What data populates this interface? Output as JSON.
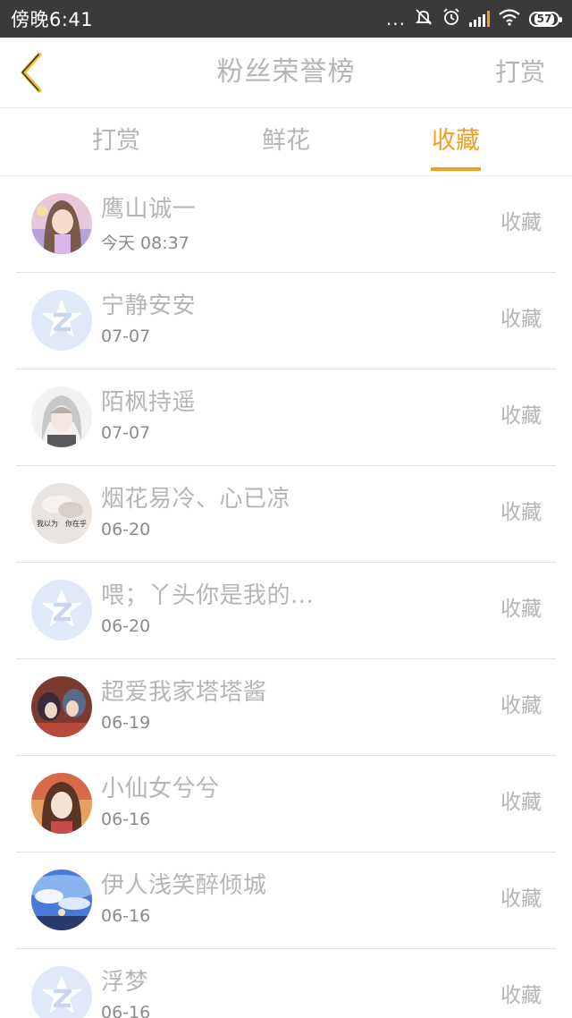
{
  "status_bar": {
    "time": "傍晚6:41",
    "dots": "...",
    "mute_glyph": "🔕",
    "alarm_glyph": "⏰",
    "wifi_glyph": "📶",
    "battery": "57"
  },
  "nav": {
    "title": "粉丝荣誉榜",
    "action": "打赏",
    "accent_color": "#f0a020"
  },
  "tabs": [
    {
      "label": "打赏",
      "active": false
    },
    {
      "label": "鲜花",
      "active": false
    },
    {
      "label": "收藏",
      "active": true
    }
  ],
  "list": [
    {
      "name": "鹰山诚一",
      "time": "今天 08:37",
      "action": "收藏",
      "avatar": "anime-girl-pastel"
    },
    {
      "name": "宁静安安",
      "time": "07-07",
      "action": "收藏",
      "avatar": "default-z-logo"
    },
    {
      "name": "陌枫持遥",
      "time": "07-07",
      "action": "收藏",
      "avatar": "anime-boy-silver"
    },
    {
      "name": "烟花易冷、心已凉",
      "time": "06-20",
      "action": "收藏",
      "avatar": "hands-photo"
    },
    {
      "name": "喂；丫头你是我的...",
      "time": "06-20",
      "action": "收藏",
      "avatar": "default-z-logo"
    },
    {
      "name": "超爱我家塔塔酱",
      "time": "06-19",
      "action": "收藏",
      "avatar": "anime-group"
    },
    {
      "name": "小仙女兮兮",
      "time": "06-16",
      "action": "收藏",
      "avatar": "anime-girl-brown"
    },
    {
      "name": "伊人浅笑醉倾城",
      "time": "06-16",
      "action": "收藏",
      "avatar": "sky-scene"
    },
    {
      "name": "浮梦",
      "time": "06-16",
      "action": "收藏",
      "avatar": "default-z-logo"
    }
  ]
}
